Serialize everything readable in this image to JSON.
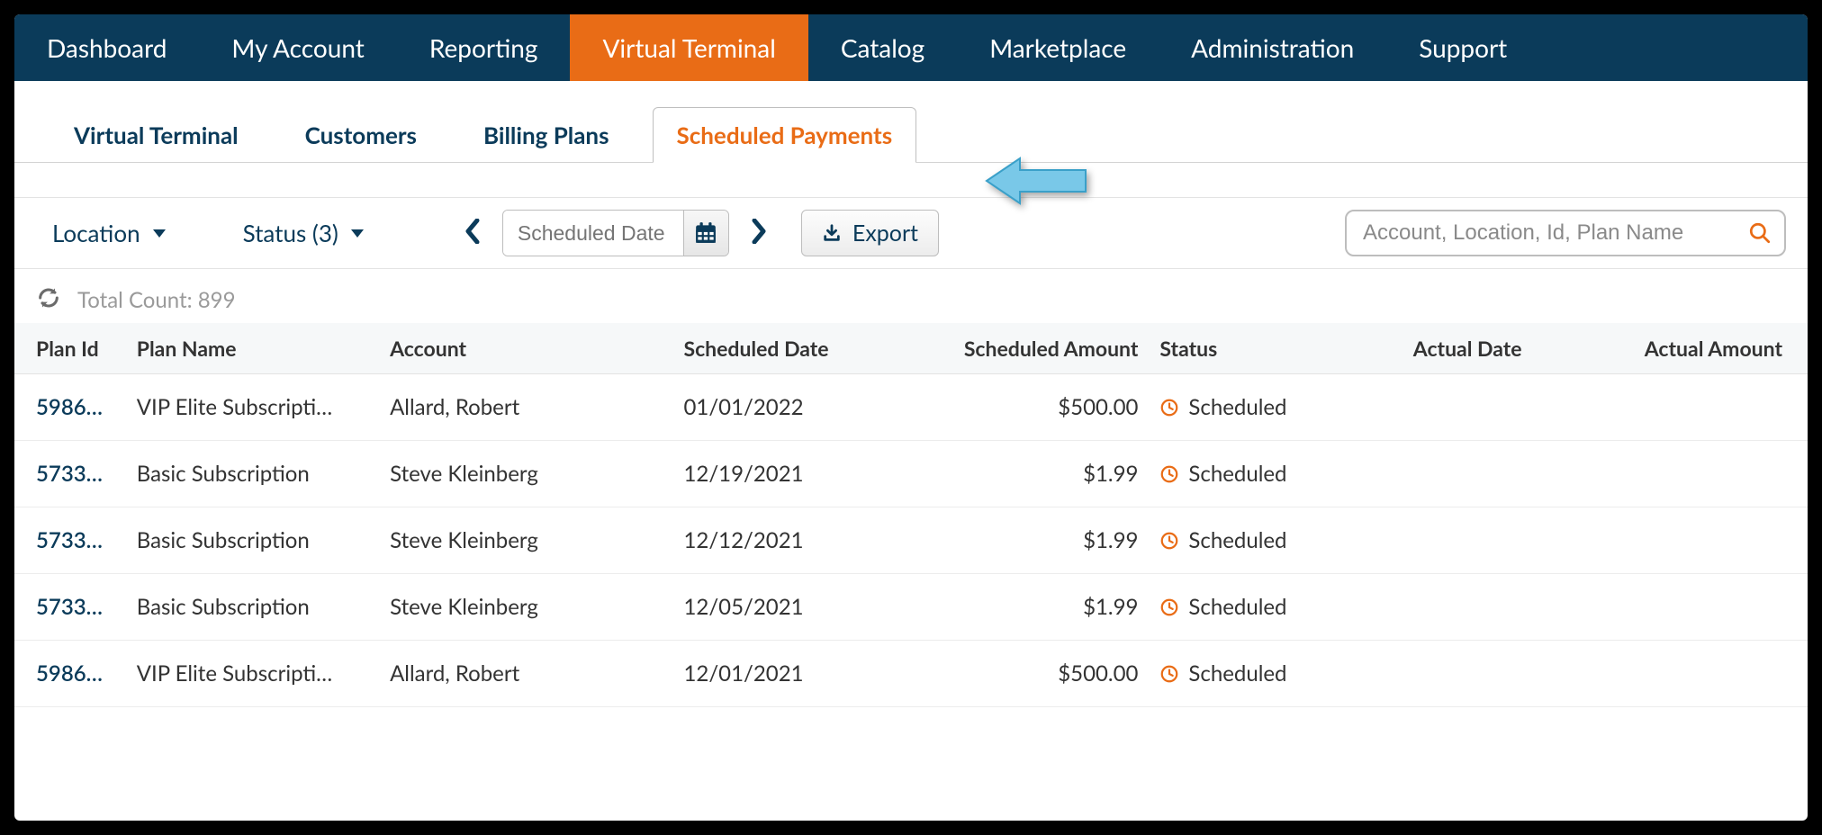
{
  "nav": {
    "items": [
      "Dashboard",
      "My Account",
      "Reporting",
      "Virtual Terminal",
      "Catalog",
      "Marketplace",
      "Administration",
      "Support"
    ],
    "activeIndex": 3
  },
  "subtabs": {
    "items": [
      "Virtual Terminal",
      "Customers",
      "Billing Plans",
      "Scheduled Payments"
    ],
    "activeIndex": 3
  },
  "filters": {
    "location_label": "Location",
    "status_label": "Status (3)",
    "date_placeholder": "Scheduled Date",
    "export_label": "Export",
    "search_placeholder": "Account, Location, Id, Plan Name"
  },
  "count": {
    "label": "Total Count: 899"
  },
  "table": {
    "headers": {
      "plan_id": "Plan Id",
      "plan_name": "Plan Name",
      "account": "Account",
      "scheduled_date": "Scheduled Date",
      "scheduled_amount": "Scheduled Amount",
      "status": "Status",
      "actual_date": "Actual Date",
      "actual_amount": "Actual Amount"
    },
    "rows": [
      {
        "plan_id": "5986…",
        "plan_name": "VIP Elite Subscripti…",
        "account": "Allard, Robert",
        "scheduled_date": "01/01/2022",
        "scheduled_amount": "$500.00",
        "status": "Scheduled",
        "actual_date": "",
        "actual_amount": ""
      },
      {
        "plan_id": "5733…",
        "plan_name": "Basic Subscription",
        "account": "Steve Kleinberg",
        "scheduled_date": "12/19/2021",
        "scheduled_amount": "$1.99",
        "status": "Scheduled",
        "actual_date": "",
        "actual_amount": ""
      },
      {
        "plan_id": "5733…",
        "plan_name": "Basic Subscription",
        "account": "Steve Kleinberg",
        "scheduled_date": "12/12/2021",
        "scheduled_amount": "$1.99",
        "status": "Scheduled",
        "actual_date": "",
        "actual_amount": ""
      },
      {
        "plan_id": "5733…",
        "plan_name": "Basic Subscription",
        "account": "Steve Kleinberg",
        "scheduled_date": "12/05/2021",
        "scheduled_amount": "$1.99",
        "status": "Scheduled",
        "actual_date": "",
        "actual_amount": ""
      },
      {
        "plan_id": "5986…",
        "plan_name": "VIP Elite Subscripti…",
        "account": "Allard, Robert",
        "scheduled_date": "12/01/2021",
        "scheduled_amount": "$500.00",
        "status": "Scheduled",
        "actual_date": "",
        "actual_amount": ""
      }
    ]
  }
}
